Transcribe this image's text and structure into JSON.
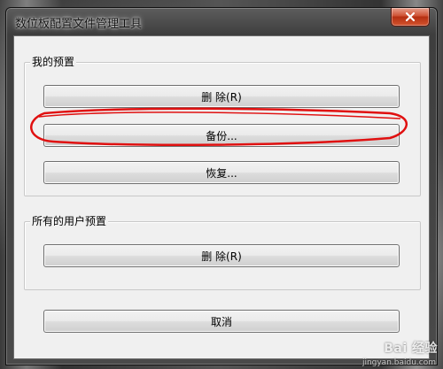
{
  "window": {
    "title": "数位板配置文件管理工具"
  },
  "my_presets": {
    "label": "我的预置",
    "delete_label": "删 除(R)",
    "backup_label": "备份...",
    "restore_label": "恢复..."
  },
  "all_users_presets": {
    "label": "所有的用户预置",
    "delete_label": "删 除(R)"
  },
  "footer": {
    "cancel_label": "取消"
  },
  "annotation": {
    "color": "#e01010",
    "target": "backup-button"
  },
  "watermark": {
    "text": "Bai 经验",
    "sub": "jingyan.baidu.com"
  }
}
